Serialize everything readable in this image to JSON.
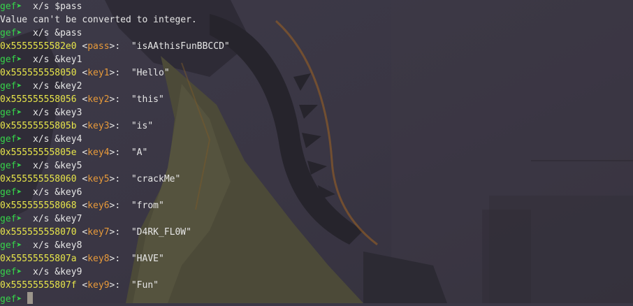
{
  "terminal": {
    "prompt": "gef➤",
    "lines": [
      {
        "kind": "cmd",
        "text": "x/s $pass"
      },
      {
        "kind": "plain",
        "text": "Value can't be converted to integer."
      },
      {
        "kind": "cmd",
        "text": "x/s &pass"
      },
      {
        "kind": "out",
        "addr": "0x5555555582e0",
        "sym": "pass",
        "value": "\"isAAthisFunBBCCD\""
      },
      {
        "kind": "cmd",
        "text": "x/s &key1"
      },
      {
        "kind": "out",
        "addr": "0x555555558050",
        "sym": "key1",
        "value": "\"Hello\""
      },
      {
        "kind": "cmd",
        "text": "x/s &key2"
      },
      {
        "kind": "out",
        "addr": "0x555555558056",
        "sym": "key2",
        "value": "\"this\""
      },
      {
        "kind": "cmd",
        "text": "x/s &key3"
      },
      {
        "kind": "out",
        "addr": "0x55555555805b",
        "sym": "key3",
        "value": "\"is\""
      },
      {
        "kind": "cmd",
        "text": "x/s &key4"
      },
      {
        "kind": "out",
        "addr": "0x55555555805e",
        "sym": "key4",
        "value": "\"A\""
      },
      {
        "kind": "cmd",
        "text": "x/s &key5"
      },
      {
        "kind": "out",
        "addr": "0x555555558060",
        "sym": "key5",
        "value": "\"crackMe\""
      },
      {
        "kind": "cmd",
        "text": "x/s &key6"
      },
      {
        "kind": "out",
        "addr": "0x555555558068",
        "sym": "key6",
        "value": "\"from\""
      },
      {
        "kind": "cmd",
        "text": "x/s &key7"
      },
      {
        "kind": "out",
        "addr": "0x555555558070",
        "sym": "key7",
        "value": "\"D4RK_FL0W\""
      },
      {
        "kind": "cmd",
        "text": "x/s &key8"
      },
      {
        "kind": "out",
        "addr": "0x55555555807a",
        "sym": "key8",
        "value": "\"HAVE\""
      },
      {
        "kind": "cmd",
        "text": "x/s &key9"
      },
      {
        "kind": "out",
        "addr": "0x55555555807f",
        "sym": "key9",
        "value": "\"Fun\""
      },
      {
        "kind": "input",
        "text": ""
      }
    ]
  },
  "colors": {
    "prompt": "#36d44a",
    "address": "#e8e64a",
    "symbol": "#e89a3a",
    "text": "#e6e6e6",
    "cursor": "#9c968c"
  }
}
